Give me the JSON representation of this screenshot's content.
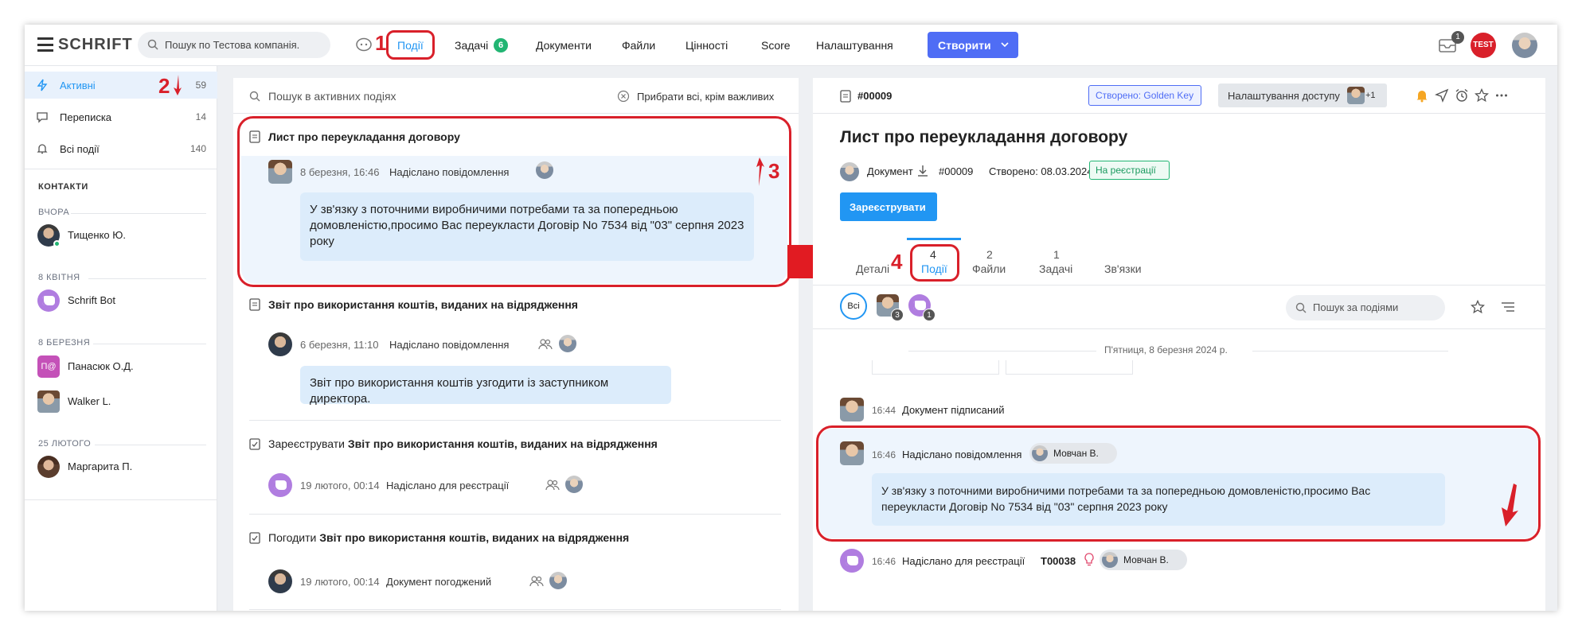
{
  "top": {
    "logo": "SCHRIFT",
    "search_placeholder": "Пошук по Тестова компанія.",
    "nav": [
      "Події",
      "Задачі",
      "Документи",
      "Файли",
      "Цінності",
      "Score",
      "Налаштування"
    ],
    "tasks_badge": "6",
    "create_label": "Створити",
    "inbox_badge": "1",
    "brand_badge": "TEST"
  },
  "sidebar": {
    "items": [
      {
        "label": "Активні",
        "count": "59"
      },
      {
        "label": "Переписка",
        "count": "14"
      },
      {
        "label": "Всі події",
        "count": "140"
      }
    ],
    "contacts_title": "КОНТАКТИ",
    "groups": [
      {
        "date": "ВЧОРА",
        "name": "Тищенко Ю."
      },
      {
        "date": "8 КВІТНЯ",
        "name": "Schrift Bot"
      },
      {
        "date": "8 БЕРЕЗНЯ",
        "name": "Панасюк О.Д.",
        "initials": "П@"
      },
      {
        "date": "",
        "name": "Walker L."
      },
      {
        "date": "25 ЛЮТОГО",
        "name": "Маргарита П."
      }
    ]
  },
  "events": {
    "search_placeholder": "Пошук в активних подіях",
    "clear_label": "Прибрати всі, крім важливих",
    "items": [
      {
        "title": "Лист про переукладання договору",
        "time": "8 березня, 16:46",
        "action": "Надіслано повідомлення",
        "message": "У зв'язку з поточними виробничими потребами та за попередньою домовленістю,просимо Вас переукласти Договір No 7534 від \"03\" серпня 2023 року"
      },
      {
        "title": "Звіт про використання коштів, виданих на відрядження",
        "time": "6 березня, 11:10",
        "action": "Надіслано повідомлення",
        "message": "Звіт про використання коштів узгодити із заступником директора."
      },
      {
        "title_prefix": "Зареєструвати",
        "title": "Звіт про використання коштів, виданих на відрядження",
        "time": "19 лютого, 00:14",
        "action": "Надіслано для реєстрації"
      },
      {
        "title_prefix": "Погодити",
        "title": "Звіт про використання коштів, виданих на відрядження",
        "time": "19 лютого, 00:14",
        "action": "Документ погоджений"
      }
    ]
  },
  "detail": {
    "number": "#00009",
    "created_by": "Створено: Golden Key",
    "access_label": "Налаштування доступу",
    "access_extra": "+1",
    "title": "Лист про переукладання договору",
    "doc_type": "Документ",
    "doc_number": "#00009",
    "created_date": "Створено: 08.03.2024",
    "status": "На реєстрації",
    "register_label": "Зареєструвати",
    "tabs": [
      {
        "count": "",
        "label": "Деталі"
      },
      {
        "count": "4",
        "label": "Події"
      },
      {
        "count": "2",
        "label": "Файли"
      },
      {
        "count": "1",
        "label": "Задачі"
      },
      {
        "count": "",
        "label": "Зв'язки"
      }
    ],
    "filter_all": "Всі",
    "filter_count_1": "3",
    "filter_count_2": "1",
    "search_placeholder": "Пошук за подіями",
    "date_divider": "П'ятниця, 8 березня 2024 р.",
    "feed": [
      {
        "time": "16:44",
        "text": "Документ підписаний"
      },
      {
        "time": "16:46",
        "text": "Надіслано повідомлення",
        "person": "Мовчан В.",
        "message": "У зв'язку з поточними виробничими потребами та за попередньою домовленістю,просимо Вас переукласти Договір No 7534 від \"03\" серпня 2023 року"
      },
      {
        "time": "16:46",
        "text": "Надіслано для реєстрації",
        "code": "T00038",
        "person": "Мовчан В."
      }
    ]
  },
  "annotations": [
    "1",
    "2",
    "3",
    "4"
  ],
  "colors": {
    "accent": "#2196f3",
    "create_button": "#4f6df5",
    "badge_green": "#22b573",
    "highlight_red": "#d9202a",
    "bubble": "#dcecfb"
  }
}
